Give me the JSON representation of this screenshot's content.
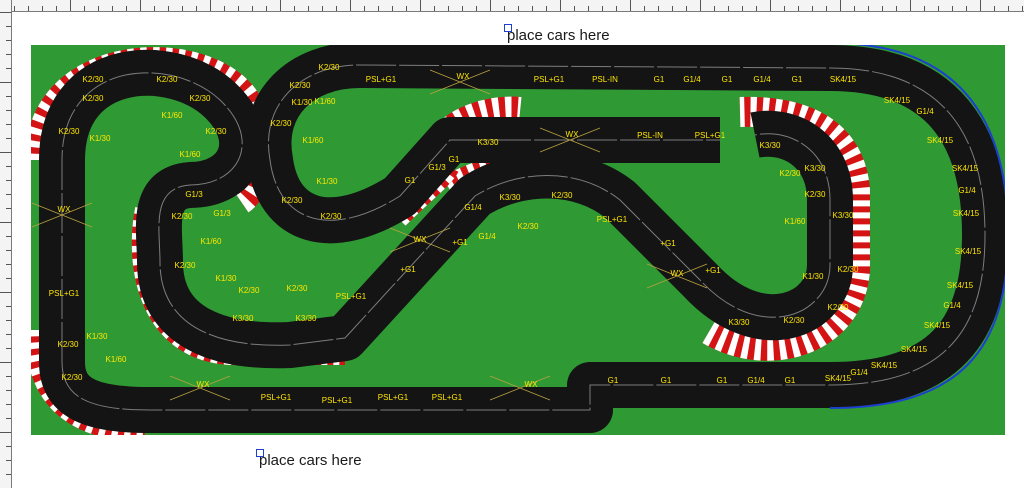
{
  "canvas": {
    "labels": {
      "top_hint": "place cars here",
      "bottom_hint": "place cars here"
    },
    "colors": {
      "table": "#2f9a34",
      "track": "#141414",
      "lane_line": "#7d7d7d",
      "piece_text": "#ffe600",
      "kerb_red": "#d41414",
      "kerb_white": "#ffffff",
      "border_blue": "#1c3fd0"
    }
  },
  "track_pieces": [
    "K2/30",
    "K2/30",
    "K2/30",
    "K2/30",
    "K2/30",
    "K1/60",
    "K1/30",
    "K1/60",
    "K2/30",
    "WX",
    "PSL+G1",
    "K1/30",
    "K1/60",
    "K2/30",
    "K2/30",
    "WX",
    "PSL+G1",
    "PSL+G1",
    "PSL+G1",
    "PSL+G1",
    "WX",
    "G1",
    "G1",
    "G1",
    "G1/4",
    "G1",
    "SK4/15",
    "G1/4",
    "SK4/15",
    "SK4/15",
    "SK4/15",
    "SK4/15",
    "G1/4",
    "SK4/15",
    "SK4/15",
    "G1/4",
    "SK4/15",
    "SK4/15",
    "G1/4",
    "SK4/15",
    "PSL+G1",
    "WX",
    "PSL+G1",
    "PSL-IN",
    "G1",
    "G1/4",
    "G1",
    "G1/4",
    "G1",
    "SK4/15",
    "K2/30",
    "K2/30",
    "K1/30",
    "K1/60",
    "K2/30",
    "K1/60",
    "K1/30",
    "K2/30",
    "K2/30",
    "G1",
    "G1/3",
    "G1",
    "K3/30",
    "WX",
    "PSL-IN",
    "PSL+G1",
    "K3/30",
    "K2/30",
    "K3/30",
    "K2/30",
    "K3/30",
    "K1/60",
    "K2/30",
    "K1/30",
    "K2/30",
    "K3/30",
    "K2/30",
    "G1/3",
    "K2/30",
    "G1/3",
    "K1/60",
    "K2/30",
    "K1/30",
    "K2/30",
    "K2/30",
    "K3/30",
    "K3/30",
    "PSL+G1",
    "+G1",
    "WX",
    "+G1",
    "G1/4",
    "K3/30",
    "K2/30",
    "K2/30",
    "G1/4",
    "PSL+G1",
    "+G1",
    "WX",
    "+G1"
  ]
}
